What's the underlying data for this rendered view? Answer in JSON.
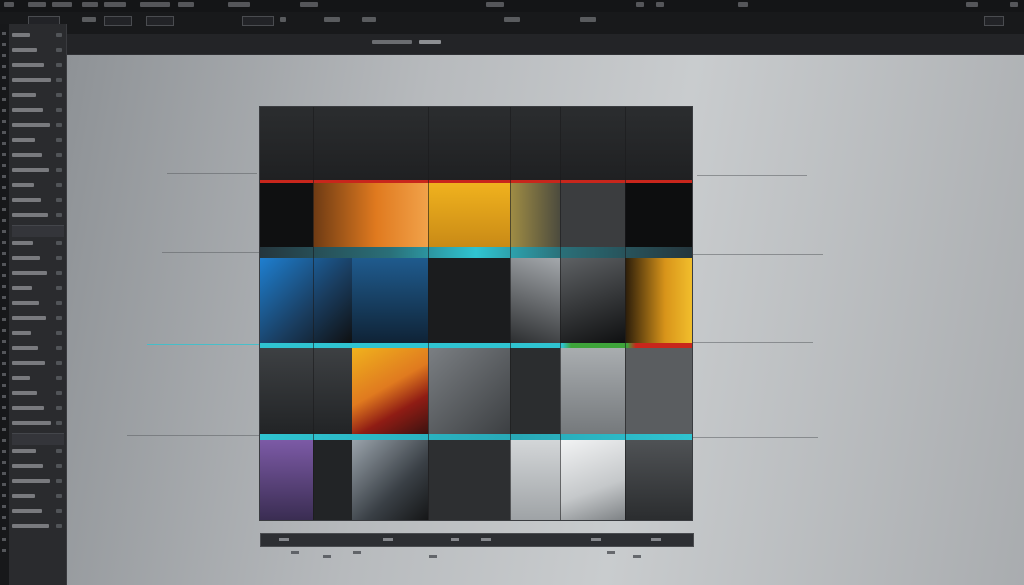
{
  "app": {
    "name": "",
    "window_title": ""
  },
  "menubar": {
    "items": [
      "",
      "",
      "",
      "",
      "",
      "",
      "",
      "",
      ""
    ]
  },
  "toolbar": {
    "controls": [
      "",
      "",
      "",
      "",
      "",
      "",
      ""
    ]
  },
  "options_bar": {
    "label": ""
  },
  "layers_panel": {
    "items": [
      "",
      "",
      "",
      "",
      "",
      "",
      "",
      "",
      "",
      "",
      "",
      "",
      "",
      "",
      "",
      "",
      "",
      "",
      "",
      "",
      "",
      "",
      "",
      "",
      "",
      "",
      "",
      "",
      "",
      "",
      "",
      ""
    ]
  },
  "canvas": {
    "palette": {
      "black": "#0f1011",
      "orange": "#e07a1f",
      "amber": "#f0b21e",
      "red": "#c8261c",
      "cyan": "#29c6d6",
      "blue": "#1e7fd0",
      "green": "#3ea43a",
      "violet": "#7c5aa6",
      "white": "#e9ebec",
      "gray": "#6a6d70"
    }
  },
  "timeline": {
    "labels": [
      "",
      "",
      "",
      "",
      ""
    ]
  }
}
